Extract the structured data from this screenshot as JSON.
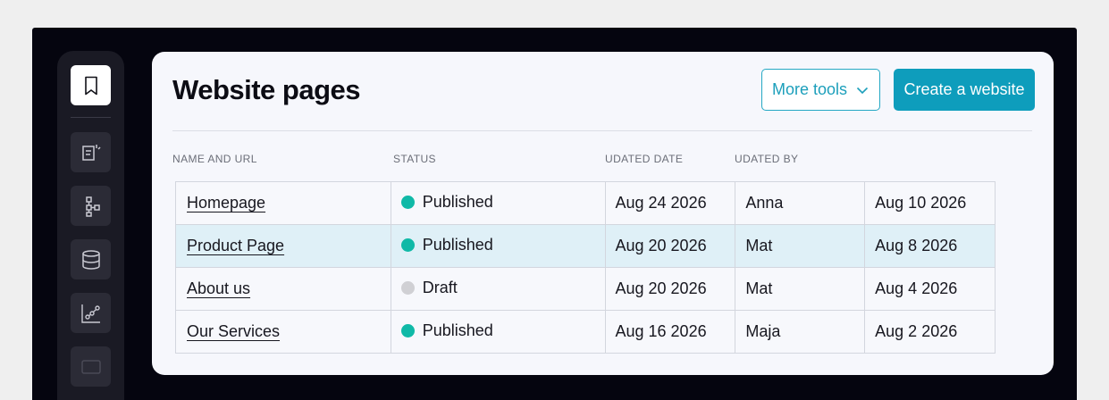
{
  "sidebar": {
    "icons": [
      "bookmark-icon",
      "page-edit-icon",
      "sitemap-icon",
      "database-icon",
      "analytics-icon",
      "window-icon"
    ]
  },
  "page": {
    "title": "Website pages"
  },
  "toolbar": {
    "more_tools_label": "More tools",
    "create_label": "Create a website"
  },
  "table": {
    "headers": [
      "NAME AND URL",
      "STATUS",
      "UDATED DATE",
      "UDATED BY"
    ],
    "rows": [
      {
        "name": "Homepage",
        "status": "Published",
        "updated_date": "Aug 24 2026",
        "updated_by": "Anna",
        "extra_date": "Aug 10 2026"
      },
      {
        "name": "Product Page",
        "status": "Published",
        "updated_date": "Aug 20 2026",
        "updated_by": "Mat",
        "extra_date": "Aug 8 2026"
      },
      {
        "name": "About us",
        "status": "Draft",
        "updated_date": "Aug 20 2026",
        "updated_by": "Mat",
        "extra_date": "Aug 4 2026"
      },
      {
        "name": "Our Services",
        "status": "Published",
        "updated_date": "Aug 16 2026",
        "updated_by": "Maja",
        "extra_date": "Aug 2 2026"
      }
    ]
  },
  "colors": {
    "accent": "#0e9dbc",
    "published": "#10b9a7",
    "draft": "#d0d0d4",
    "row_highlight": "#dff0f7"
  }
}
